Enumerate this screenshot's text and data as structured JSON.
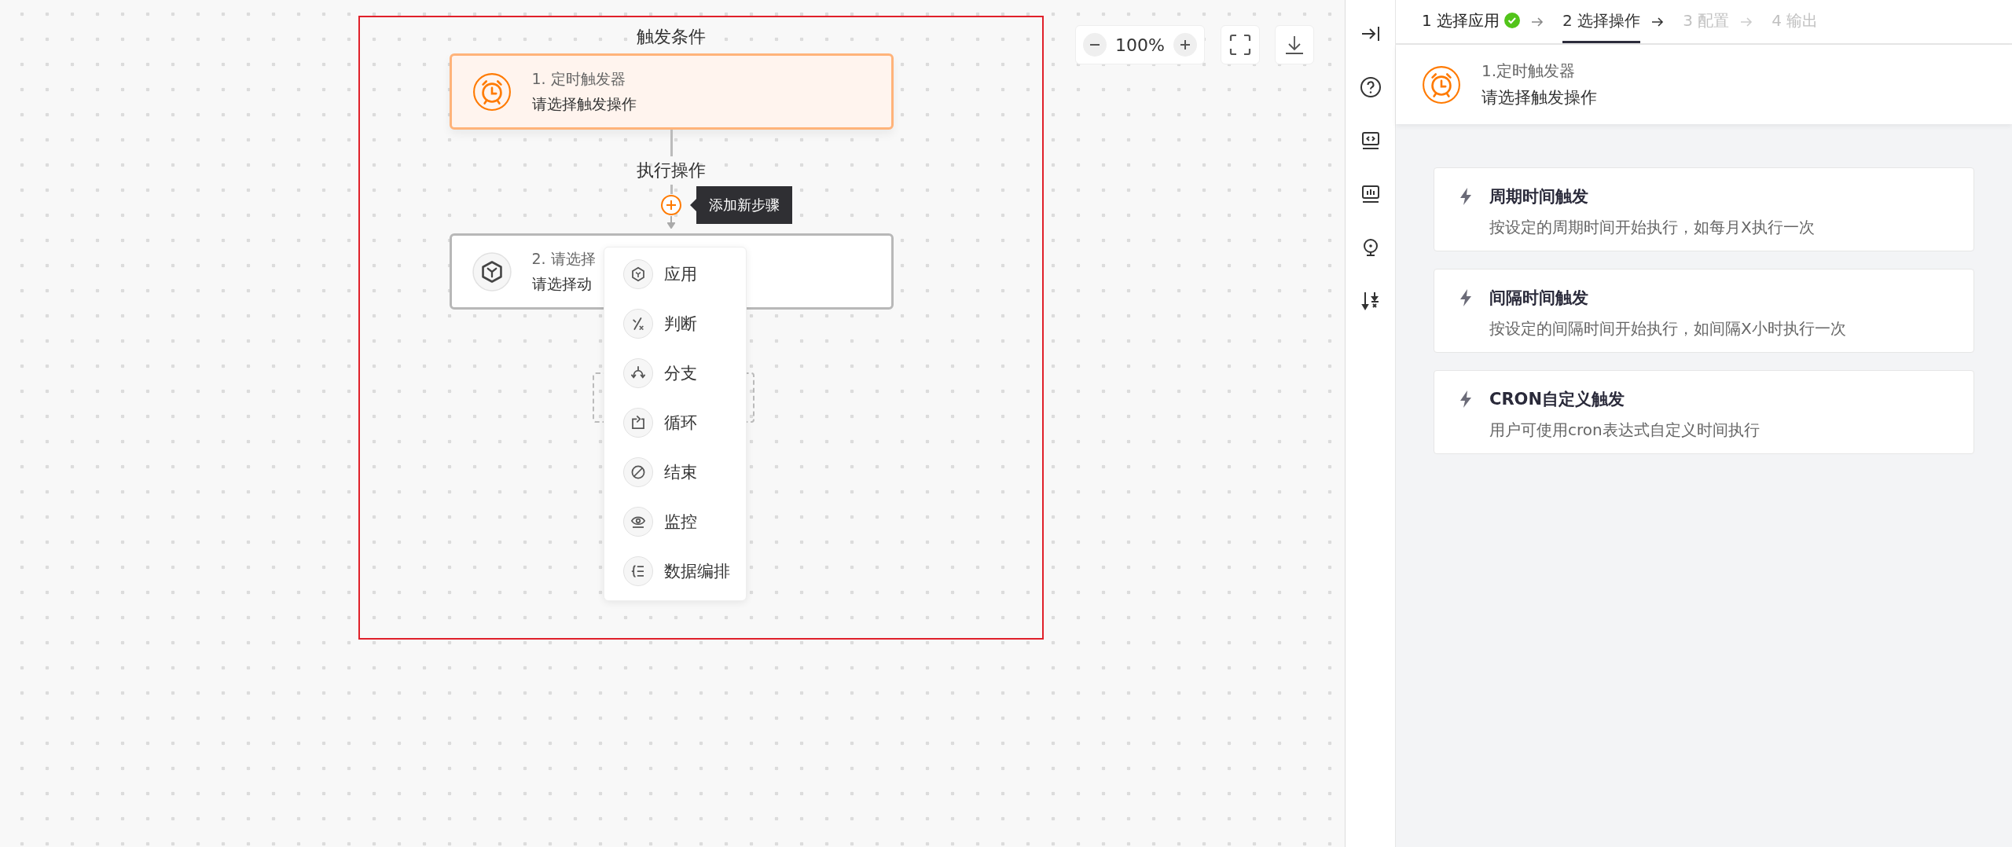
{
  "canvas": {
    "section_label": "触发条件",
    "action_label": "执行操作",
    "nodes": [
      {
        "kind": "trigger",
        "title": "1. 定时触发器",
        "subtitle": "请选择触发操作",
        "selected": true
      },
      {
        "kind": "app",
        "title": "2. 请选择",
        "subtitle": "请选择动",
        "selected": false
      }
    ],
    "tooltip": "添加新步骤",
    "menu": [
      {
        "kind": "app",
        "label": "应用"
      },
      {
        "kind": "judge",
        "label": "判断"
      },
      {
        "kind": "branch",
        "label": "分支"
      },
      {
        "kind": "loop",
        "label": "循环"
      },
      {
        "kind": "end",
        "label": "结束"
      },
      {
        "kind": "monitor",
        "label": "监控"
      },
      {
        "kind": "data",
        "label": "数据编排"
      }
    ],
    "zoom": "100%"
  },
  "steps": [
    {
      "label": "1 选择应用",
      "done": true,
      "disabled": false,
      "selected": false
    },
    {
      "label": "2 选择操作",
      "done": false,
      "disabled": false,
      "selected": true
    },
    {
      "label": "3 配置",
      "done": false,
      "disabled": true,
      "selected": false
    },
    {
      "label": "4 输出",
      "done": false,
      "disabled": true,
      "selected": false
    }
  ],
  "header": {
    "title": "1.定时触发器",
    "subtitle": "请选择触发操作"
  },
  "options": [
    {
      "title": "周期时间触发",
      "description": "按设定的周期时间开始执行，如每月X执行一次"
    },
    {
      "title": "间隔时间触发",
      "description": "按设定的间隔时间开始执行，如间隔X小时执行一次"
    },
    {
      "title": "CRON自定义触发",
      "description": "用户可使用cron表达式自定义时间执行"
    }
  ]
}
